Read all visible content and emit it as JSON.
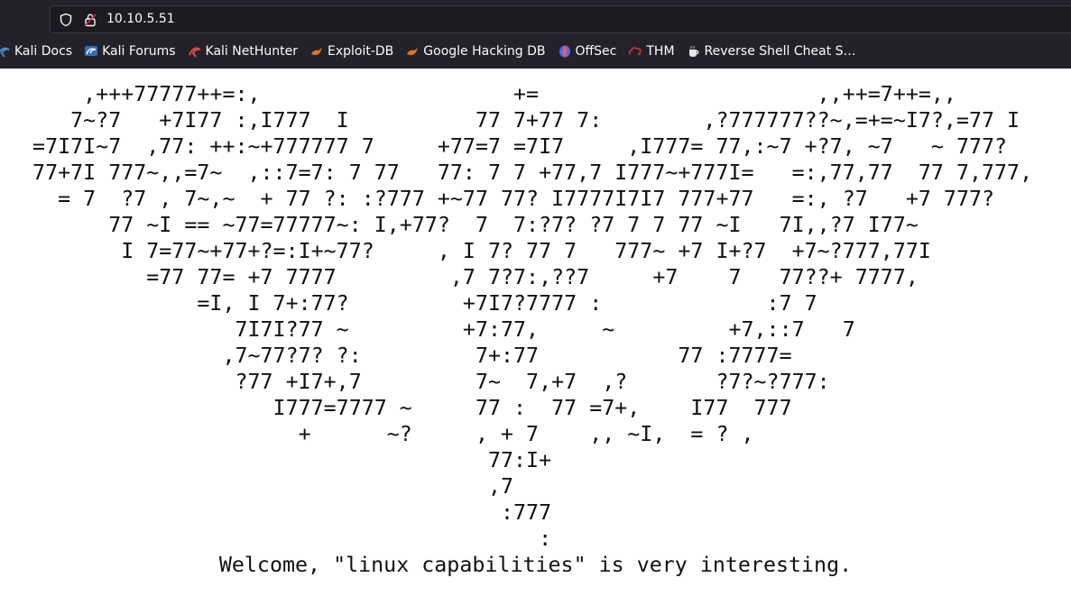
{
  "browser": {
    "url": "10.10.5.51",
    "bookmarks": [
      {
        "label": "Kali Docs",
        "icon": "kali-docs-icon",
        "color": "#4a8fd6"
      },
      {
        "label": "Kali Forums",
        "icon": "kali-forums-icon",
        "color": "#4a8fd6"
      },
      {
        "label": "Kali NetHunter",
        "icon": "kali-nethunter-icon",
        "color": "#e04a4a"
      },
      {
        "label": "Exploit-DB",
        "icon": "exploit-db-icon",
        "color": "#e8741e"
      },
      {
        "label": "Google Hacking DB",
        "icon": "ghdb-icon",
        "color": "#e8741e"
      },
      {
        "label": "OffSec",
        "icon": "offsec-icon",
        "color": "#7a5cff"
      },
      {
        "label": "THM",
        "icon": "thm-icon",
        "color": "#d0303a"
      },
      {
        "label": "Reverse Shell Cheat S…",
        "icon": "coffee-cup-icon",
        "color": "#e0e0e0"
      }
    ]
  },
  "page": {
    "ascii_art": "      ,+++77777++=:,                    +=                      ,,++=7++=,,\n     7~?7   +7I77 :,I777  I          77 7+77 7:        ,?777777??~,=+=~I7?,=77 I\n  =7I7I~7  ,77: ++:~+777777 7     +77=7 =7I7     ,I777= 77,:~7 +?7, ~7   ~ 777?\n  77+7I 777~,,=7~  ,::7=7: 7 77   77: 7 7 +77,7 I777~+777I=   =:,77,77  77 7,777,\n    = 7  ?7 , 7~,~  + 77 ?: :?777 +~77 77? I7777I7I7 777+77   =:, ?7   +7 777?\n        77 ~I == ~77=77777~: I,+77?  7  7:?7? ?7 7 7 77 ~I   7I,,?7 I77~\n         I 7=77~+77+?=:I+~77?     , I 7? 77 7   777~ +7 I+?7  +7~?777,77I\n           =77 77= +7 7777         ,7 7?7:,??7     +7    7   77??+ 7777,\n               =I, I 7+:77?         +7I7?7777 :             :7 7\n                  7I7I?77 ~         +7:77,     ~         +7,::7   7\n                 ,7~77?7? ?:         7+:77           77 :7777=\n                  ?77 +I7+,7         7~  7,+7  ,?       ?7?~?777:\n                     I777=7777 ~     77 :  77 =7+,    I77  777\n                       +      ~?     , + 7    ,, ~I,  = ? ,\n                                      77:I+\n                                      ,7\n                                       :777\n                                          :",
    "welcome": "Welcome, \"linux capabilities\" is very interesting."
  }
}
